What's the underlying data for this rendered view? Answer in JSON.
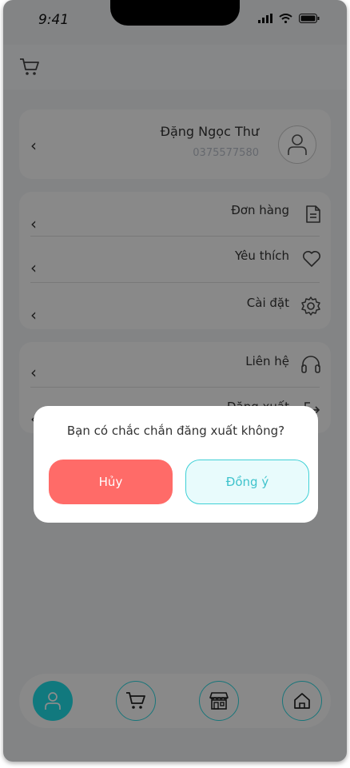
{
  "status_bar": {
    "time": "9:41"
  },
  "profile": {
    "name": "Đặng Ngọc Thư",
    "phone": "0375577580"
  },
  "menu": {
    "items": [
      {
        "label": "Đơn hàng",
        "icon": "document-icon"
      },
      {
        "label": "Yêu thích",
        "icon": "heart-icon"
      },
      {
        "label": "Cài đặt",
        "icon": "gear-icon"
      }
    ]
  },
  "contact": {
    "items": [
      {
        "label": "Liên hệ",
        "icon": "headset-icon"
      },
      {
        "label": "Đăng xuất",
        "icon": "logout-icon"
      }
    ]
  },
  "dialog": {
    "message": "Bạn có chắc chắn đăng xuất không?",
    "cancel_label": "Hủy",
    "confirm_label": "Đồng ý"
  },
  "bottom_nav": {
    "items": [
      {
        "icon": "user-icon",
        "active": true
      },
      {
        "icon": "cart-icon",
        "active": false
      },
      {
        "icon": "store-icon",
        "active": false
      },
      {
        "icon": "home-icon",
        "active": false
      }
    ]
  },
  "colors": {
    "accent": "#1fdde5",
    "cancel": "#ff6b68",
    "overlay": "#000000"
  },
  "chevron": "‹"
}
